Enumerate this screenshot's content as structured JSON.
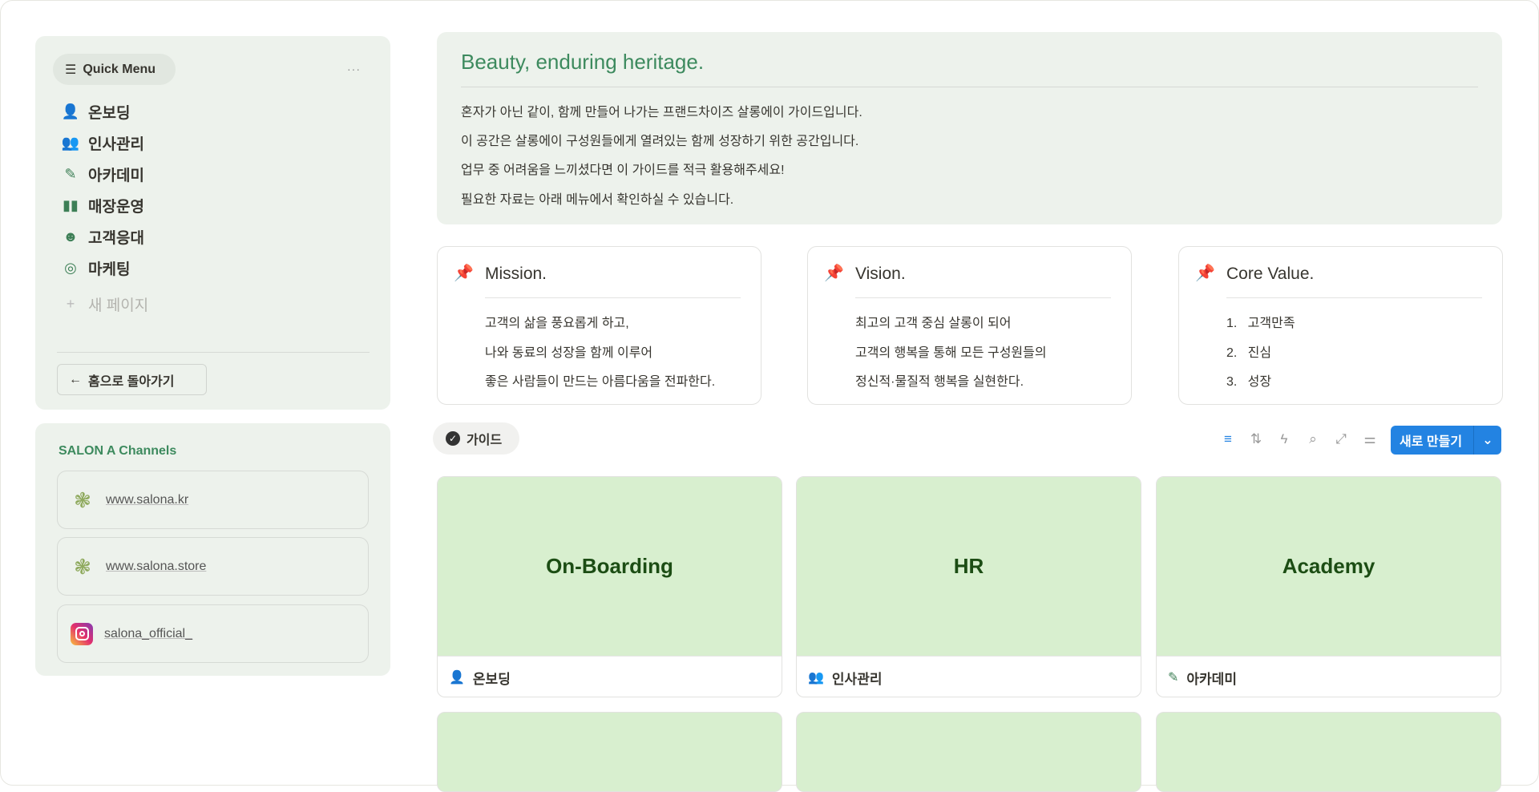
{
  "quick_menu": {
    "title": "Quick Menu",
    "more": "···",
    "items": [
      {
        "icon": "person-add-icon",
        "glyph": "👤",
        "label": "온보딩"
      },
      {
        "icon": "group-icon",
        "glyph": "👥",
        "label": "인사관리"
      },
      {
        "icon": "pencil-icon",
        "glyph": "✎",
        "label": "아카데미"
      },
      {
        "icon": "book-icon",
        "glyph": "📖",
        "label": "매장운영"
      },
      {
        "icon": "smile-icon",
        "glyph": "☻",
        "label": "고객응대"
      },
      {
        "icon": "target-icon",
        "glyph": "◎",
        "label": "마케팅"
      }
    ],
    "new_page": "새 페이지",
    "back": "홈으로 돌아가기"
  },
  "channels": {
    "title": "SALON A Channels",
    "links": [
      "www.salona.kr",
      "www.salona.store",
      "salona_official_"
    ]
  },
  "header": {
    "title": "Beauty, enduring heritage.",
    "lines": [
      "혼자가 아닌 같이, 함께 만들어 나가는 프랜드차이즈 살롱에이 가이드입니다.",
      "이 공간은 살롱에이 구성원들에게 열려있는 함께 성장하기 위한 공간입니다.",
      "업무 중 어려움을 느끼셨다면 이 가이드를 적극 활용해주세요!",
      "필요한 자료는 아래 메뉴에서 확인하실 수 있습니다."
    ]
  },
  "cards": [
    {
      "title": "Mission.",
      "lines": [
        "고객의 삶을 풍요롭게 하고,",
        "나와 동료의 성장을 함께 이루어",
        "좋은 사람들이 만드는 아름다움을 전파한다."
      ]
    },
    {
      "title": "Vision.",
      "lines": [
        "최고의 고객 중심 살롱이 되어",
        "고객의 행복을 통해 모든 구성원들의",
        "정신적·물질적 행복을 실현한다."
      ]
    },
    {
      "title": "Core Value.",
      "lines": [
        "1.   고객만족",
        "2.   진심",
        "3.   성장"
      ]
    }
  ],
  "view": {
    "tab": "가이드",
    "new_button": "새로 만들기"
  },
  "gallery": [
    {
      "cover": "On-Boarding",
      "label": "온보딩"
    },
    {
      "cover": "HR",
      "label": "인사관리"
    },
    {
      "cover": "Academy",
      "label": "아카데미"
    }
  ],
  "colors": {
    "accent": "#2383e2",
    "brand_green": "#3d8a5e",
    "cover": "#d8efcf"
  }
}
